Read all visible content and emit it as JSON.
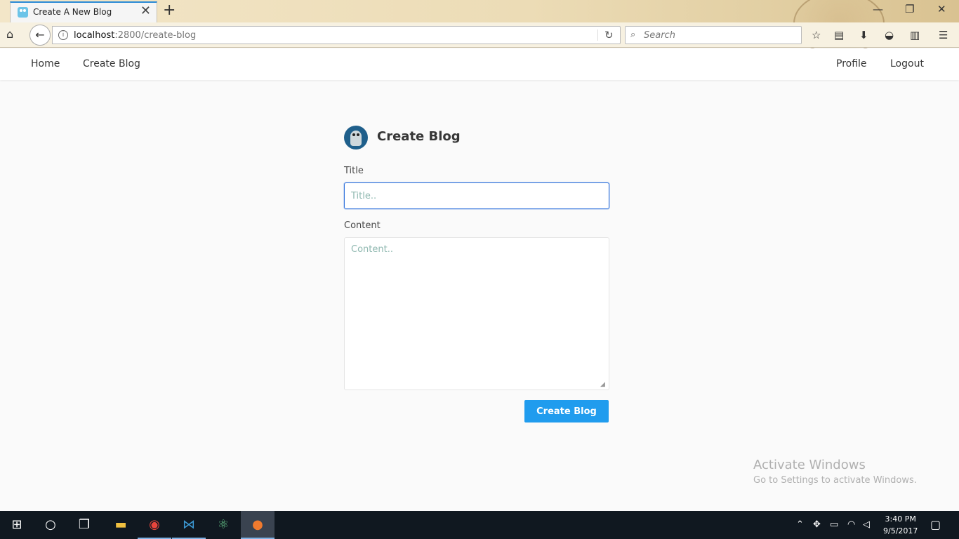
{
  "browser": {
    "tab_title": "Create A New Blog",
    "tab_close": "✕",
    "new_tab": "+",
    "url_host": "localhost",
    "url_path": ":2800/create-blog",
    "search_placeholder": "Search",
    "window_controls": {
      "minimize": "—",
      "maximize": "❐",
      "close": "✕"
    }
  },
  "site_nav": {
    "home": "Home",
    "create_blog": "Create Blog",
    "profile": "Profile",
    "logout": "Logout"
  },
  "form": {
    "heading": "Create Blog",
    "title_label": "Title",
    "title_placeholder": "Title..",
    "title_value": "",
    "content_label": "Content",
    "content_placeholder": "Content..",
    "content_value": "",
    "submit_label": "Create Blog"
  },
  "watermark": {
    "title": "Activate Windows",
    "subtitle": "Go to Settings to activate Windows."
  },
  "taskbar": {
    "time": "3:40 PM",
    "date": "9/5/2017"
  },
  "colors": {
    "accent": "#209cee",
    "focus_border": "#3273dc",
    "placeholder": "#8fb8b0"
  }
}
